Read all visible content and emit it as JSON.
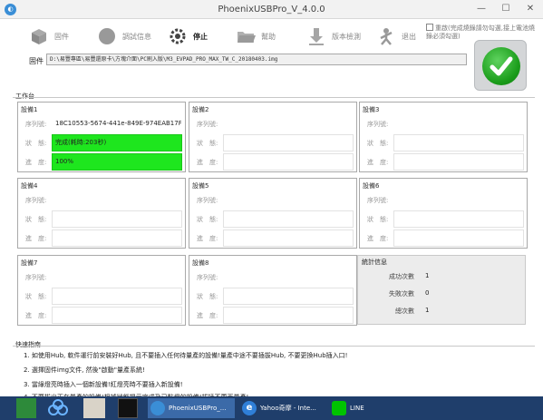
{
  "window": {
    "title": "PhoenixUSBPro_V_4.0.0",
    "minimize": "—",
    "maximize": "☐",
    "close": "✕"
  },
  "toolbar": {
    "items": [
      {
        "label": "固件",
        "icon": "package-icon",
        "active": false
      },
      {
        "label": "調試信息",
        "icon": "circle-icon",
        "active": false
      },
      {
        "label": "停止",
        "icon": "gear-icon",
        "active": true
      },
      {
        "label": "幫助",
        "icon": "folder-icon",
        "active": false
      },
      {
        "label": "版本檢測",
        "icon": "download-icon",
        "active": false
      },
      {
        "label": "退出",
        "icon": "person-icon",
        "active": false
      }
    ]
  },
  "option": {
    "label": "重啟(完成燒錄請勿勾選,接上電池燒錄必須勾選)",
    "checked": false
  },
  "firmware": {
    "label": "固件",
    "path": "D:\\易豐專區\\易豐還原卡\\方塊介面\\PC刷入版\\M3_EVPAD_PRO_MAX_TW_C_20180403.img"
  },
  "workstation": {
    "label": "工作台",
    "field_labels": {
      "serial": "序列號:",
      "status": "狀　態:",
      "progress": "進　度:"
    },
    "devices": [
      {
        "name": "設備1",
        "serial": "18C10553-5674-441e-849E-974EAB17F8FB",
        "status": "完成(耗時:203秒)",
        "progress": "100%",
        "highlight": true
      },
      {
        "name": "設備2",
        "serial": "",
        "status": "",
        "progress": "",
        "highlight": false
      },
      {
        "name": "設備3",
        "serial": "",
        "status": "",
        "progress": "",
        "highlight": false
      },
      {
        "name": "設備4",
        "serial": "",
        "status": "",
        "progress": "",
        "highlight": false
      },
      {
        "name": "設備5",
        "serial": "",
        "status": "",
        "progress": "",
        "highlight": false
      },
      {
        "name": "設備6",
        "serial": "",
        "status": "",
        "progress": "",
        "highlight": false
      },
      {
        "name": "設備7",
        "serial": "",
        "status": "",
        "progress": "",
        "highlight": false
      },
      {
        "name": "設備8",
        "serial": "",
        "status": "",
        "progress": "",
        "highlight": false
      }
    ]
  },
  "stats": {
    "title": "統計信息",
    "rows": [
      {
        "label": "成功次數",
        "value": "1"
      },
      {
        "label": "失敗次數",
        "value": "0"
      },
      {
        "label": "總次數",
        "value": "1"
      }
    ]
  },
  "quickstart": {
    "label": "快速指南",
    "items": [
      "1. 如使用Hub, 軟件運行前安裝好Hub, 且不要插入任何待量產的設備!量產中途不要插拔Hub, 不要更換Hub插入口!",
      "2. 選擇固件img文件, 然後\"啟動\"量產系統!",
      "3. 當綠燈亮時插入一個新設備!紅燈亮時不要插入新設備!",
      "4. 不要拔出正在量產的設備!根據狀態提示完成及已點燈的設備!拔插不要再量產!"
    ]
  },
  "taskbar": {
    "apps": [
      {
        "label": "PhoenixUSBPro_...",
        "icon": "phoenix-icon"
      },
      {
        "label": "Yahoo奇摩 - Inte...",
        "icon": "ie-icon"
      },
      {
        "label": "LINE",
        "icon": "line-icon"
      }
    ]
  },
  "colors": {
    "status_green": "#1ee61e",
    "check_green": "#1a9c1a",
    "taskbar": "#1f3e6b"
  }
}
